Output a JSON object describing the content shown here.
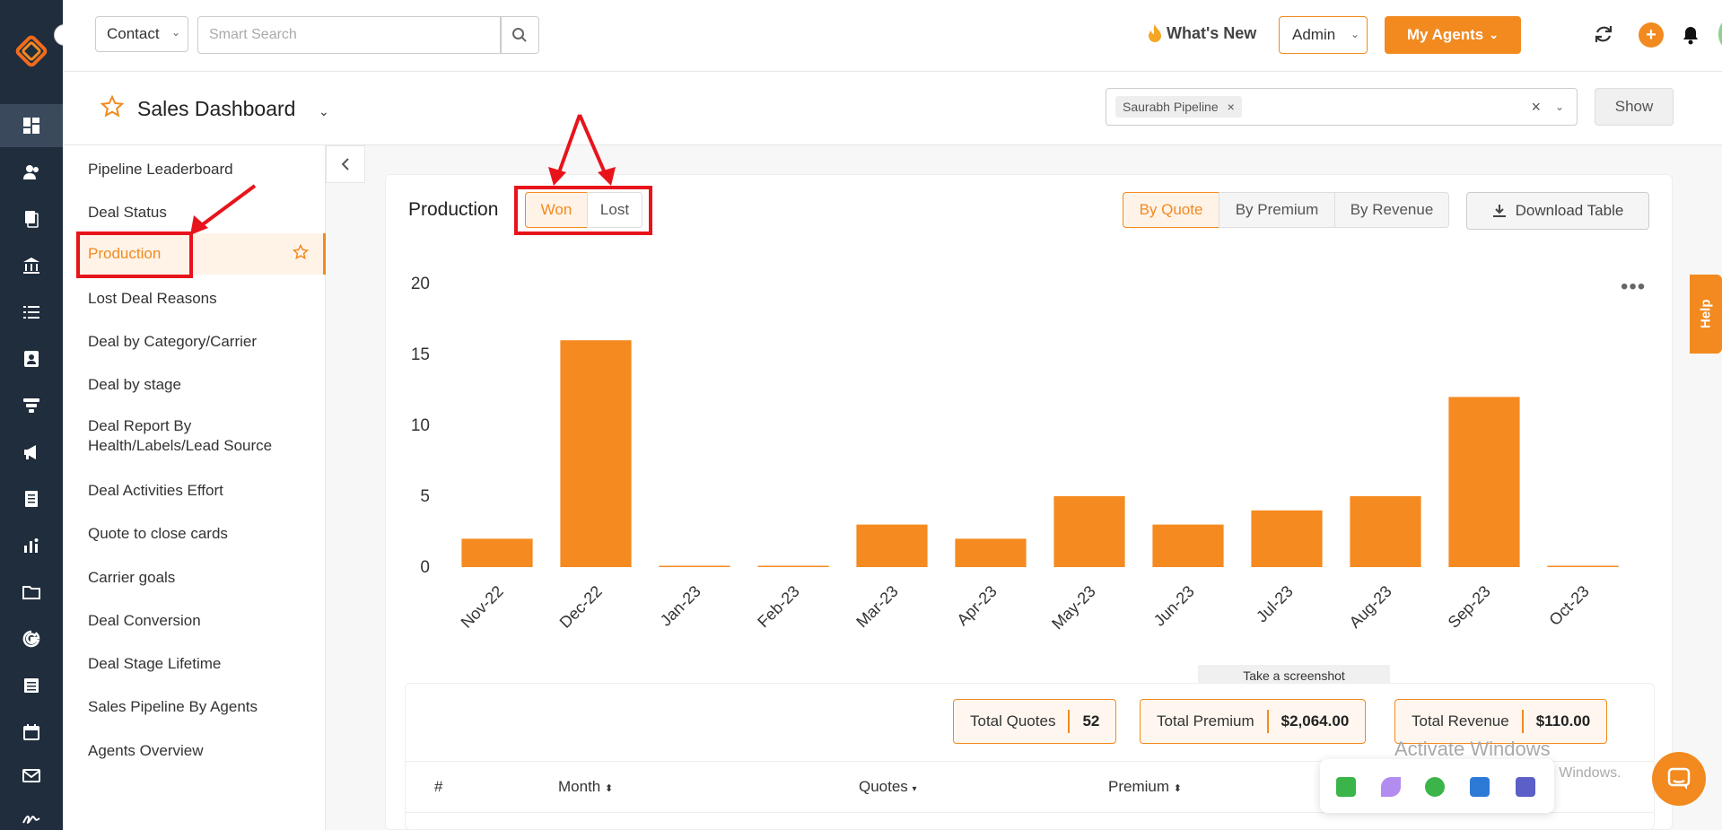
{
  "header": {
    "contact_select": "Contact",
    "search_placeholder": "Smart Search",
    "whats_new": "What's New",
    "admin_select": "Admin",
    "agents_button": "My Agents"
  },
  "dashboard": {
    "title": "Sales Dashboard",
    "pipeline_tag": "Saurabh Pipeline",
    "pipeline_tag_remove": "×",
    "pipeline_clear": "×",
    "show_button": "Show"
  },
  "nav": {
    "items": [
      "Pipeline Leaderboard",
      "Deal Status",
      "Production",
      "Lost Deal Reasons",
      "Deal by Category/Carrier",
      "Deal by stage",
      "Deal Report By Health/Labels/Lead Source",
      "Deal Activities Effort",
      "Quote to close cards",
      "Carrier goals",
      "Deal Conversion",
      "Deal Stage Lifetime",
      "Sales Pipeline By Agents",
      "Agents Overview"
    ],
    "active": "Production"
  },
  "production": {
    "title": "Production",
    "toggle_won": "Won",
    "toggle_lost": "Lost",
    "by_quote": "By Quote",
    "by_premium": "By Premium",
    "by_revenue": "By Revenue",
    "download": "Download Table"
  },
  "chart_data": {
    "type": "bar",
    "categories": [
      "Nov-22",
      "Dec-22",
      "Jan-23",
      "Feb-23",
      "Mar-23",
      "Apr-23",
      "May-23",
      "Jun-23",
      "Jul-23",
      "Aug-23",
      "Sep-23",
      "Oct-23"
    ],
    "values": [
      2,
      16,
      0,
      0,
      3,
      2,
      5,
      3,
      4,
      5,
      12,
      0
    ],
    "yticks": [
      0,
      5,
      10,
      15,
      20
    ],
    "ylim": [
      0,
      20
    ],
    "color": "#f58a20",
    "grid": false
  },
  "tooltip": "Take a screenshot",
  "stats": {
    "total_quotes_label": "Total Quotes",
    "total_quotes_value": "52",
    "total_premium_label": "Total Premium",
    "total_premium_value": "$2,064.00",
    "total_revenue_label": "Total Revenue",
    "total_revenue_value": "$110.00"
  },
  "table": {
    "columns": [
      "#",
      "Month",
      "Quotes",
      "Premium"
    ]
  },
  "help": "Help",
  "windows": {
    "title": "Activate Windows",
    "subtitle": "Go to Settings to activate Windows."
  },
  "colors": {
    "accent": "#f28a1f",
    "rail": "#1f2d3d",
    "annotation": "#e8141b"
  }
}
